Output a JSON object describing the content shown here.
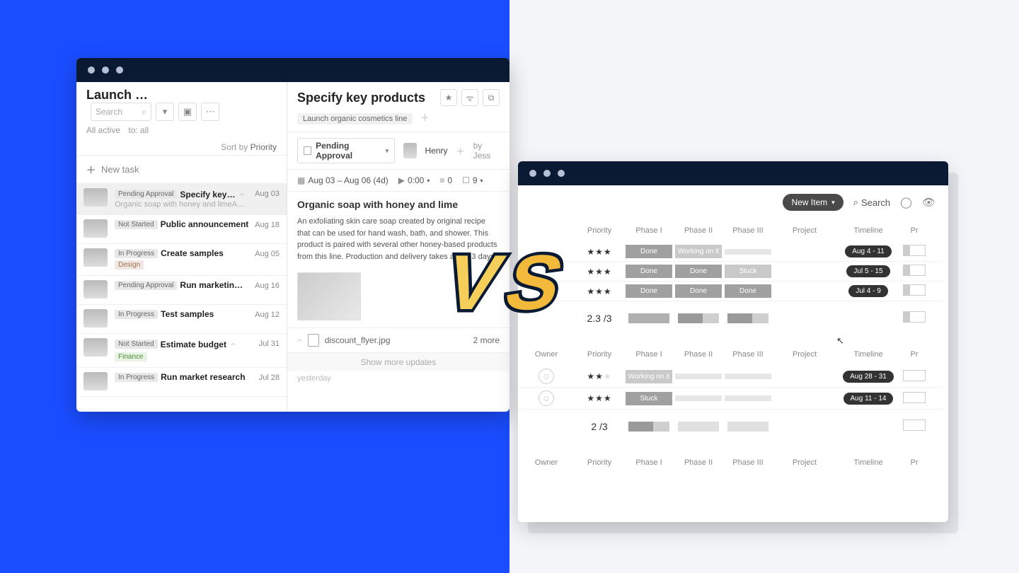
{
  "left_window": {
    "header": {
      "title": "Launch …",
      "search_placeholder": "Search",
      "filters_sub": {
        "all_active": "All active",
        "to_all": "to: all"
      },
      "sort_label": "Sort by",
      "sort_value": "Priority"
    },
    "new_task_label": "New task",
    "tasks": [
      {
        "status": "Pending Approval",
        "title": "Specify key…",
        "subtitle": "Organic soap with honey and limeAn exfoliating …",
        "date": "Aug 03",
        "has_attachment": true,
        "selected": true
      },
      {
        "status": "Not Started",
        "title": "Public announcement",
        "date": "Aug 18"
      },
      {
        "status": "In Progress",
        "title": "Create samples",
        "date": "Aug 05",
        "tag": "Design"
      },
      {
        "status": "Pending Approval",
        "title": "Run marketin…",
        "date": "Aug 16"
      },
      {
        "status": "In Progress",
        "title": "Test samples",
        "date": "Aug 12"
      },
      {
        "status": "Not Started",
        "title": "Estimate budget",
        "date": "Jul 31",
        "has_attachment": true,
        "tag": "Finance",
        "tag_class": "finance"
      },
      {
        "status": "In Progress",
        "title": "Run market research",
        "date": "Jul 28"
      }
    ],
    "detail": {
      "title": "Specify key products",
      "parent_tag": "Launch organic cosmetics line",
      "status_label": "Pending Approval",
      "assignee_name": "Henry",
      "byline_prefix": "by",
      "byline_name": "Jess",
      "date_range": "Aug 03 – Aug 06 (4d)",
      "timer": "0:00",
      "subtasks_count": "0",
      "checklist_count": "9",
      "body_heading": "Organic soap with honey and lime",
      "body_text": "An exfoliating skin care soap created by original recipe that can be used for hand wash, bath, and shower. This product is paired with several other honey-based products from this line. Production and delivery takes about 3 days.",
      "attachment_name": "discount_flyer.jpg",
      "attachment_more": "2 more",
      "show_more": "Show more updates",
      "yesterday": "yesterday"
    }
  },
  "right_window": {
    "toolbar": {
      "new_item": "New Item",
      "search": "Search"
    },
    "columns": [
      "Owner",
      "Priority",
      "Phase I",
      "Phase II",
      "Phase III",
      "Project",
      "Timeline",
      "Pr"
    ],
    "groups": [
      {
        "rows": [
          {
            "stars": 3,
            "phase1": "Done",
            "phase2": "Working on it",
            "phase3": "",
            "timeline": "Aug 4 - 11"
          },
          {
            "stars": 3,
            "phase1": "Done",
            "phase2": "Done",
            "phase3": "Stuck",
            "timeline": "Jul 5 - 15"
          },
          {
            "stars": 3,
            "phase1": "Done",
            "phase2": "Done",
            "phase3": "Done",
            "timeline": "Jul 4 - 9"
          }
        ],
        "summary": "2.3 /3"
      },
      {
        "rows": [
          {
            "stars": 2,
            "phase1": "Working on it",
            "phase2": "",
            "phase3": "",
            "timeline": "Aug 28 - 31"
          },
          {
            "stars": 3,
            "phase1": "Stuck",
            "phase2": "",
            "phase3": "",
            "timeline": "Aug 11 - 14"
          }
        ],
        "summary": "2 /3"
      }
    ]
  },
  "vs": "vs"
}
